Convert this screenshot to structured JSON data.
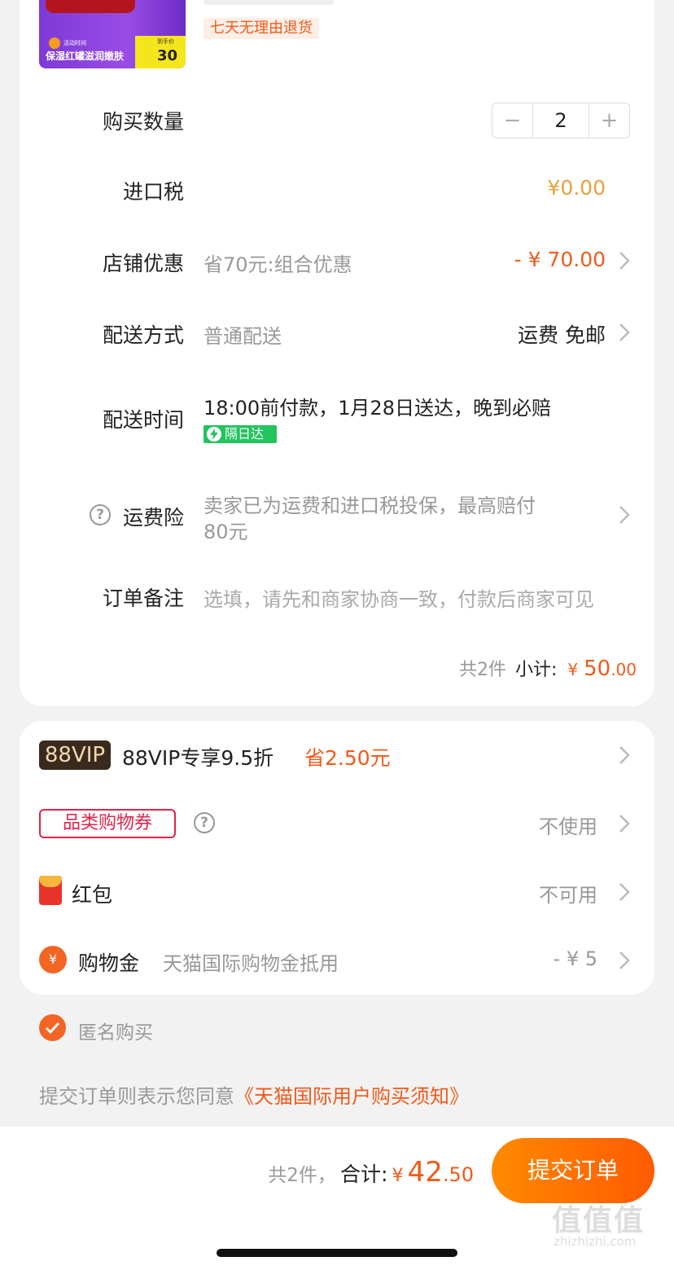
{
  "product": {
    "promo_line": "保湿红罐滋润嫩肤",
    "promo_small": "活动时间",
    "promo_price_label": "到手价",
    "promo_price": "30",
    "return_policy": "七天无理由退货"
  },
  "quantity": {
    "label": "购买数量",
    "minus": "−",
    "plus": "+",
    "value": "2"
  },
  "import_tax": {
    "label": "进口税",
    "value": "¥0.00"
  },
  "store_discount": {
    "label": "店铺优惠",
    "desc": "省70元:组合优惠",
    "value": "- ¥ 70.00"
  },
  "delivery_method": {
    "label": "配送方式",
    "desc": "普通配送",
    "value": "运费 免邮"
  },
  "delivery_time": {
    "label": "配送时间",
    "desc": "18:00前付款，1月28日送达，晚到必赔",
    "badge": "隔日达"
  },
  "shipping_insurance": {
    "label": "运费险",
    "desc_line1": "卖家已为运费和进口税投保，最高赔付",
    "desc_line2": "80元"
  },
  "order_note": {
    "label": "订单备注",
    "placeholder": "选填，请先和商家协商一致，付款后商家可见"
  },
  "subtotal": {
    "count": "共2件",
    "label": "小计:",
    "currency": "¥",
    "int": "50",
    "dec": ".00"
  },
  "vip": {
    "badge": "88VIP",
    "text": "88VIP专享9.5折",
    "save": "省2.50元"
  },
  "category_coupon": {
    "badge": "品类购物券",
    "value": "不使用"
  },
  "red_packet": {
    "label": "红包",
    "value": "不可用"
  },
  "shopping_gold": {
    "icon": "¥",
    "label": "购物金",
    "desc": "天猫国际购物金抵用",
    "value": "- ¥ 5"
  },
  "anonymous": {
    "label": "匿名购买"
  },
  "agreement": {
    "prefix": "提交订单则表示您同意",
    "link": "《天猫国际用户购买须知》"
  },
  "footer": {
    "count": "共2件，",
    "total_label": "合计:",
    "currency": "¥",
    "total_int": "42",
    "total_dec": ".50",
    "submit": "提交订单"
  },
  "watermark": {
    "text": "值值值",
    "url": "zhizhizhi.com"
  },
  "colors": {
    "accent": "#f25a1a",
    "gold": "#e8a13a",
    "coupon_red": "#e2234a",
    "express_green": "#22c45e"
  }
}
